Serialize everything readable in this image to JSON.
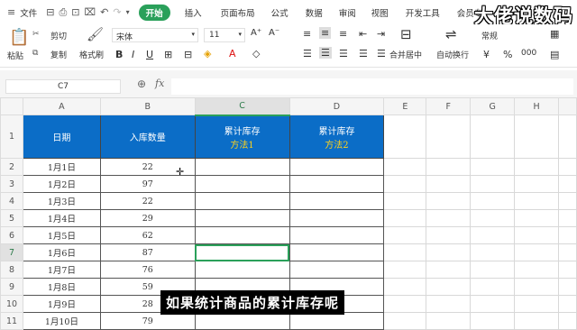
{
  "menu": {
    "file": "文件",
    "tabs": [
      "开始",
      "插入",
      "页面布局",
      "公式",
      "数据",
      "审阅",
      "视图",
      "开发工具",
      "会员专"
    ],
    "active_tab": "开始"
  },
  "watermark": "大佬说数码",
  "ribbon": {
    "paste": "粘贴",
    "cut": "剪切",
    "copy": "复制",
    "format_painter": "格式刷",
    "font_name": "宋体",
    "font_size": "11",
    "merge_center": "合并居中",
    "wrap_text": "自动换行",
    "number_format": "常规",
    "currency_symbol": "¥",
    "percent_symbol": "%",
    "thousands": "000"
  },
  "formula_bar": {
    "cell_ref": "C7",
    "fx": "fx",
    "value": ""
  },
  "sheet": {
    "columns": [
      "A",
      "B",
      "C",
      "D",
      "E",
      "F",
      "G",
      "H"
    ],
    "header_row": {
      "row_num": "1",
      "a": "日期",
      "b": "入库数量",
      "c_line1": "累计库存",
      "c_line2": "方法1",
      "d_line1": "累计库存",
      "d_line2": "方法2"
    },
    "rows": [
      {
        "num": "2",
        "date": "1月1日",
        "qty": "22"
      },
      {
        "num": "3",
        "date": "1月2日",
        "qty": "97"
      },
      {
        "num": "4",
        "date": "1月3日",
        "qty": "22"
      },
      {
        "num": "5",
        "date": "1月4日",
        "qty": "29"
      },
      {
        "num": "6",
        "date": "1月5日",
        "qty": "62"
      },
      {
        "num": "7",
        "date": "1月6日",
        "qty": "87"
      },
      {
        "num": "8",
        "date": "1月7日",
        "qty": "76"
      },
      {
        "num": "9",
        "date": "1月8日",
        "qty": "59"
      },
      {
        "num": "10",
        "date": "1月9日",
        "qty": "28"
      },
      {
        "num": "11",
        "date": "1月10日",
        "qty": "79"
      }
    ]
  },
  "subtitle": "如果统计商品的累计库存呢",
  "colors": {
    "accent": "#2aa05a",
    "header_blue": "#0b6dc7",
    "header_yellow": "#ffd21a"
  }
}
